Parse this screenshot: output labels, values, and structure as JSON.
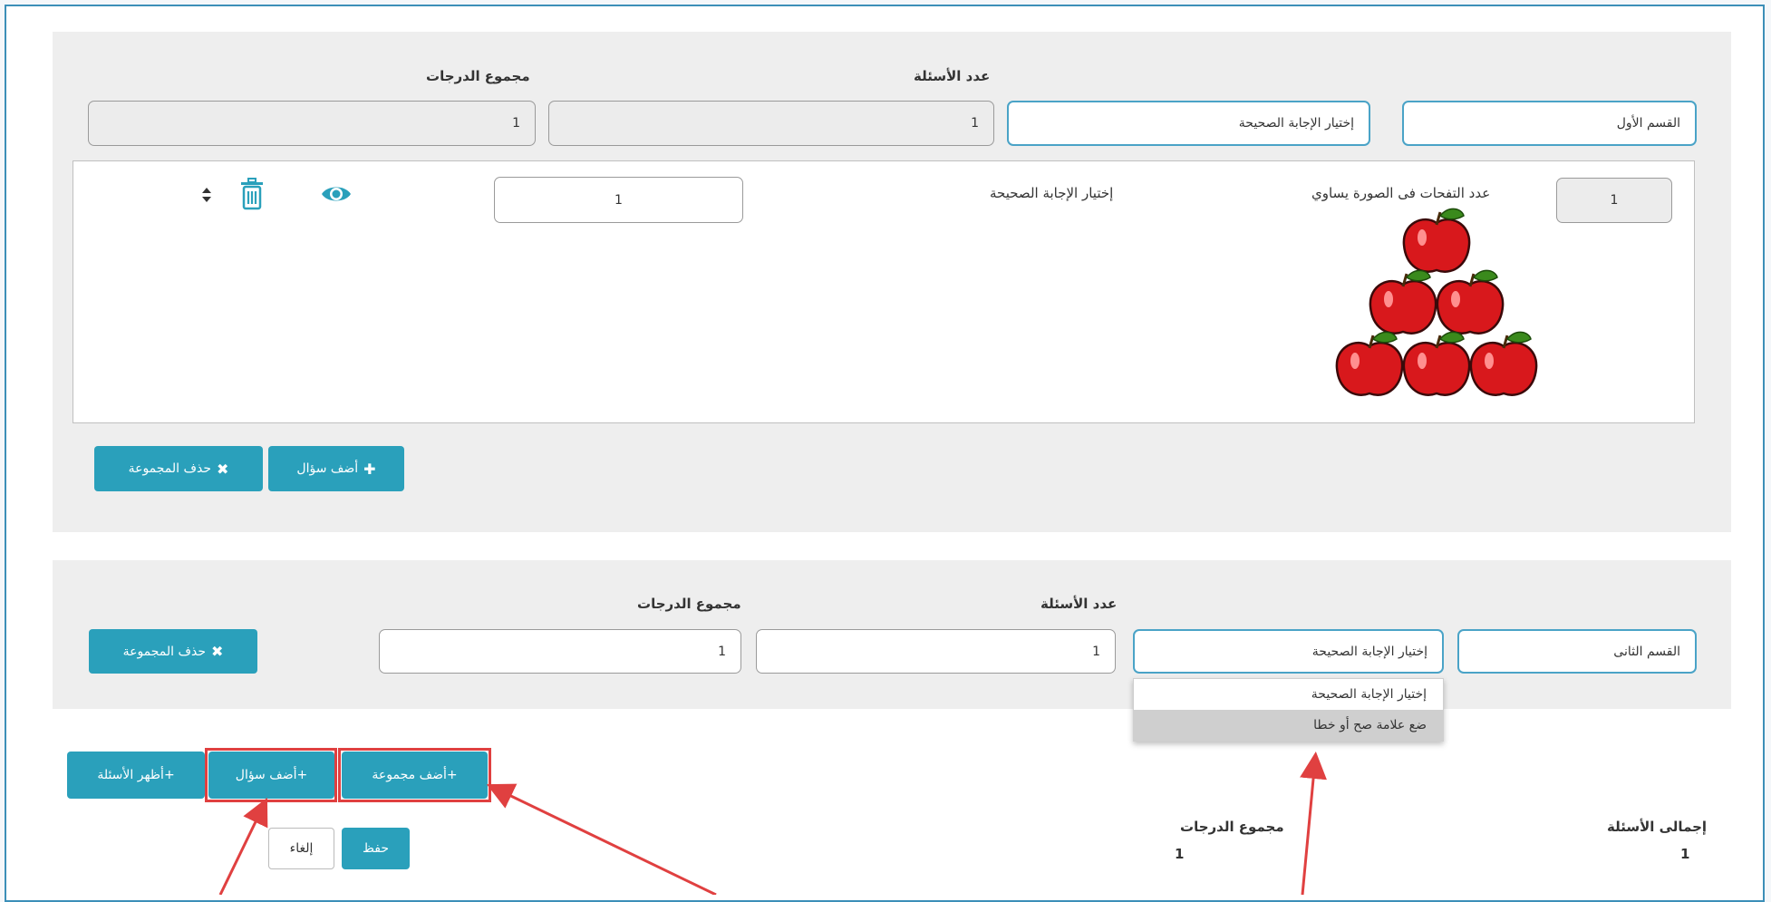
{
  "section1": {
    "label_grades_total": "مجموع الدرجات",
    "label_questions_count": "عدد الأسئلة",
    "name_value": "القسم الأول",
    "type_value": "إختيار الإجابة الصحيحة",
    "questions_count_value": "1",
    "grades_total_value": "1",
    "question": {
      "number": "1",
      "text": "عدد التفحات فى الصورة يساوي",
      "type": "إختيار الإجابة الصحيحة",
      "grade": "1",
      "apple_count": 6
    },
    "add_question_label": "أضف سؤال",
    "delete_group_label": "حذف المجموعة"
  },
  "section2": {
    "label_grades_total": "مجموع الدرجات",
    "label_questions_count": "عدد الأسئلة",
    "name_value": "القسم الثانى",
    "type_value": "إختيار الإجابة الصحيحة",
    "questions_count_value": "1",
    "grades_total_value": "1",
    "delete_group_label": "حذف المجموعة",
    "dropdown_options": [
      "إختيار الإجابة الصحيحة",
      "ضع علامة صح أو خطا"
    ]
  },
  "actions": {
    "add_group_label": "+أضف مجموعة",
    "add_question_label": "+أضف سؤال",
    "show_questions_label": "+أظهر الأسئلة",
    "save_label": "حفظ",
    "cancel_label": "إلغاء"
  },
  "summary": {
    "total_questions_label": "إجمالى الأسئلة",
    "total_questions_value": "1",
    "total_grades_label": "مجموع الدرجات",
    "total_grades_value": "1"
  },
  "colors": {
    "accent": "#2aa0bb",
    "highlight": "#e04040",
    "frame": "#3c8fb8"
  }
}
